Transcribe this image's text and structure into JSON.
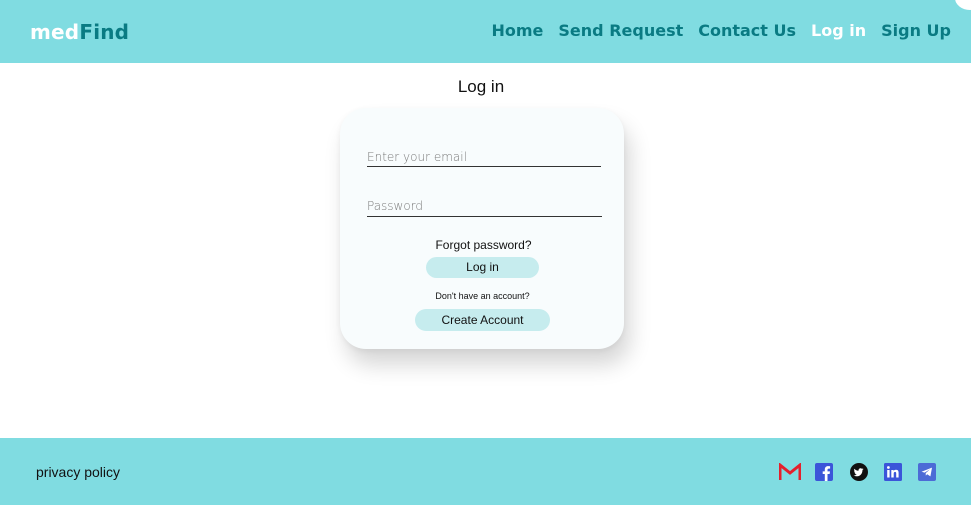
{
  "header": {
    "logo_part1": "med",
    "logo_part2": "Find",
    "nav": [
      {
        "label": "Home"
      },
      {
        "label": "Send Request"
      },
      {
        "label": "Contact Us"
      },
      {
        "label": "Log in",
        "active": true
      },
      {
        "label": "Sign Up"
      }
    ]
  },
  "page": {
    "title": "Log in"
  },
  "login_form": {
    "email_placeholder": "Enter your email",
    "email_value": "",
    "password_placeholder": "Password",
    "password_value": "",
    "forgot_password": "Forgot password?",
    "login_button": "Log in",
    "no_account_text": "Don't have an account?",
    "create_account_button": "Create Account"
  },
  "footer": {
    "privacy_link": "privacy policy",
    "social": [
      {
        "icon": "gmail-icon",
        "color": "#e5202c"
      },
      {
        "icon": "facebook-icon",
        "color": "#3b55d9"
      },
      {
        "icon": "twitter-icon",
        "color": "#111111"
      },
      {
        "icon": "linkedin-icon",
        "color": "#3b55d9"
      },
      {
        "icon": "telegram-icon",
        "color": "#4c6bd6"
      }
    ]
  },
  "colors": {
    "header_bg": "#80dce1",
    "brand_teal": "#0a7b83",
    "button_bg": "#c6ecee",
    "card_bg": "#f8fcfd"
  }
}
